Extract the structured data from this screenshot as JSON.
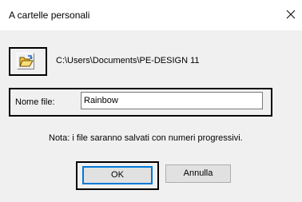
{
  "window": {
    "title": "A cartelle personali",
    "close_glyph": "✕"
  },
  "folder": {
    "icon": "open-folder-icon",
    "path": "C:\\Users\\Documents\\PE-DESIGN 11"
  },
  "file_name": {
    "label": "Nome file:",
    "value": "Rainbow"
  },
  "note": "Nota: i file saranno salvati con numeri progressivi.",
  "buttons": {
    "ok": "OK",
    "cancel": "Annulla"
  },
  "colors": {
    "titlebar_bg": "#ffffff",
    "dialog_bg": "#f0f0f0",
    "focus_accent": "#0078d7",
    "highlight_box": "#000000"
  }
}
